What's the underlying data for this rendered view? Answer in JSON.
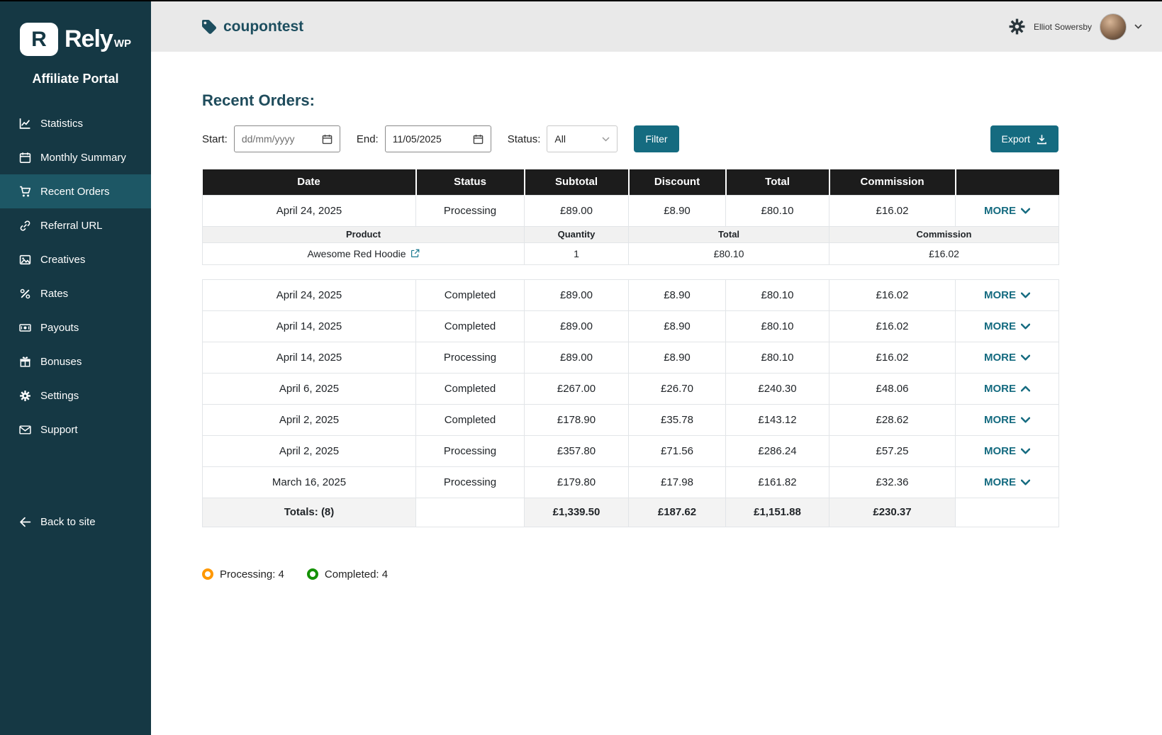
{
  "sidebar": {
    "logo": {
      "mark": "R",
      "brand": "Rely",
      "suffix": "WP"
    },
    "portal_title": "Affiliate Portal",
    "items": [
      {
        "label": "Statistics",
        "icon": "chart-line-icon",
        "active": false
      },
      {
        "label": "Monthly Summary",
        "icon": "calendar-icon",
        "active": false
      },
      {
        "label": "Recent Orders",
        "icon": "cart-icon",
        "active": true
      },
      {
        "label": "Referral URL",
        "icon": "link-icon",
        "active": false
      },
      {
        "label": "Creatives",
        "icon": "image-icon",
        "active": false
      },
      {
        "label": "Rates",
        "icon": "percent-icon",
        "active": false
      },
      {
        "label": "Payouts",
        "icon": "banknote-icon",
        "active": false
      },
      {
        "label": "Bonuses",
        "icon": "gift-icon",
        "active": false
      },
      {
        "label": "Settings",
        "icon": "gear-icon",
        "active": false
      },
      {
        "label": "Support",
        "icon": "envelope-icon",
        "active": false
      }
    ],
    "back_label": "Back to site"
  },
  "header": {
    "title": "coupontest",
    "user_name": "Elliot Sowersby"
  },
  "main": {
    "heading": "Recent Orders:",
    "filters": {
      "start_label": "Start:",
      "start_placeholder": "dd/mm/yyyy",
      "end_label": "End:",
      "end_value": "11/05/2025",
      "status_label": "Status:",
      "status_value": "All",
      "filter_button": "Filter",
      "export_button": "Export"
    },
    "table": {
      "headers": [
        "Date",
        "Status",
        "Subtotal",
        "Discount",
        "Total",
        "Commission",
        ""
      ],
      "more_label": "MORE",
      "rows": [
        {
          "date": "April 24, 2025",
          "status": "Processing",
          "subtotal": "£89.00",
          "discount": "£8.90",
          "total": "£80.10",
          "commission": "£16.02",
          "chevron": "down",
          "expanded": true
        },
        {
          "date": "April 24, 2025",
          "status": "Completed",
          "subtotal": "£89.00",
          "discount": "£8.90",
          "total": "£80.10",
          "commission": "£16.02",
          "chevron": "down",
          "expanded": false
        },
        {
          "date": "April 14, 2025",
          "status": "Completed",
          "subtotal": "£89.00",
          "discount": "£8.90",
          "total": "£80.10",
          "commission": "£16.02",
          "chevron": "down",
          "expanded": false
        },
        {
          "date": "April 14, 2025",
          "status": "Processing",
          "subtotal": "£89.00",
          "discount": "£8.90",
          "total": "£80.10",
          "commission": "£16.02",
          "chevron": "down",
          "expanded": false
        },
        {
          "date": "April 6, 2025",
          "status": "Completed",
          "subtotal": "£267.00",
          "discount": "£26.70",
          "total": "£240.30",
          "commission": "£48.06",
          "chevron": "up",
          "expanded": false
        },
        {
          "date": "April 2, 2025",
          "status": "Completed",
          "subtotal": "£178.90",
          "discount": "£35.78",
          "total": "£143.12",
          "commission": "£28.62",
          "chevron": "down",
          "expanded": false
        },
        {
          "date": "April 2, 2025",
          "status": "Processing",
          "subtotal": "£357.80",
          "discount": "£71.56",
          "total": "£286.24",
          "commission": "£57.25",
          "chevron": "down",
          "expanded": false
        },
        {
          "date": "March 16, 2025",
          "status": "Processing",
          "subtotal": "£179.80",
          "discount": "£17.98",
          "total": "£161.82",
          "commission": "£32.36",
          "chevron": "down",
          "expanded": false
        }
      ],
      "detail": {
        "headers": [
          "Product",
          "Quantity",
          "Total",
          "Commission"
        ],
        "rows": [
          {
            "product": "Awesome Red Hoodie",
            "quantity": "1",
            "total": "£80.10",
            "commission": "£16.02"
          }
        ]
      },
      "totals": {
        "label": "Totals: (8)",
        "subtotal": "£1,339.50",
        "discount": "£187.62",
        "total": "£1,151.88",
        "commission": "£230.37"
      }
    },
    "legend": [
      {
        "label": "Processing: 4",
        "color": "#FF9800"
      },
      {
        "label": "Completed: 4",
        "color": "#149104"
      }
    ]
  },
  "colors": {
    "sidebar_bg": "#153844",
    "sidebar_active_bg": "#1d5765",
    "accent_teal": "#156b80",
    "table_header_bg": "#1c1c1c",
    "header_bar_bg": "#e9e9e9"
  }
}
